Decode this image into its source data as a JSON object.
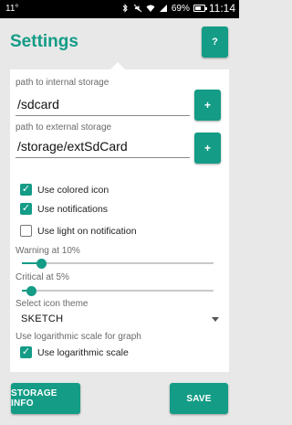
{
  "status_bar": {
    "left_text": "11°",
    "battery_percent": "69%",
    "time": "11:14",
    "icons": [
      "bluetooth-icon",
      "mute-icon",
      "wifi-icon",
      "signal-icon",
      "battery-icon"
    ]
  },
  "header": {
    "title": "Settings",
    "help_label": "?"
  },
  "storage": {
    "internal_label": "path to internal storage",
    "internal_value": "/sdcard",
    "internal_button": "+",
    "external_label": "path to external storage",
    "external_value": "/storage/extSdCard",
    "external_button": "+"
  },
  "options": {
    "colored_icon": {
      "label": "Use colored icon",
      "checked": true
    },
    "notifications": {
      "label": "Use notifications",
      "checked": true
    },
    "light_notification": {
      "label": "Use light on notification",
      "checked": false
    }
  },
  "warning": {
    "label": "Warning at 10%",
    "value_percent": 10
  },
  "critical": {
    "label": "Critical at 5%",
    "value_percent": 5
  },
  "theme": {
    "label": "Select icon theme",
    "selected": "SKETCH"
  },
  "log_scale": {
    "label": "Use logarithmic scale for graph",
    "checkbox_label": "Use logarithmic scale",
    "checked": true
  },
  "actions": {
    "storage_info": "STORAGE INFO",
    "save": "SAVE"
  },
  "colors": {
    "accent": "#149c86"
  }
}
